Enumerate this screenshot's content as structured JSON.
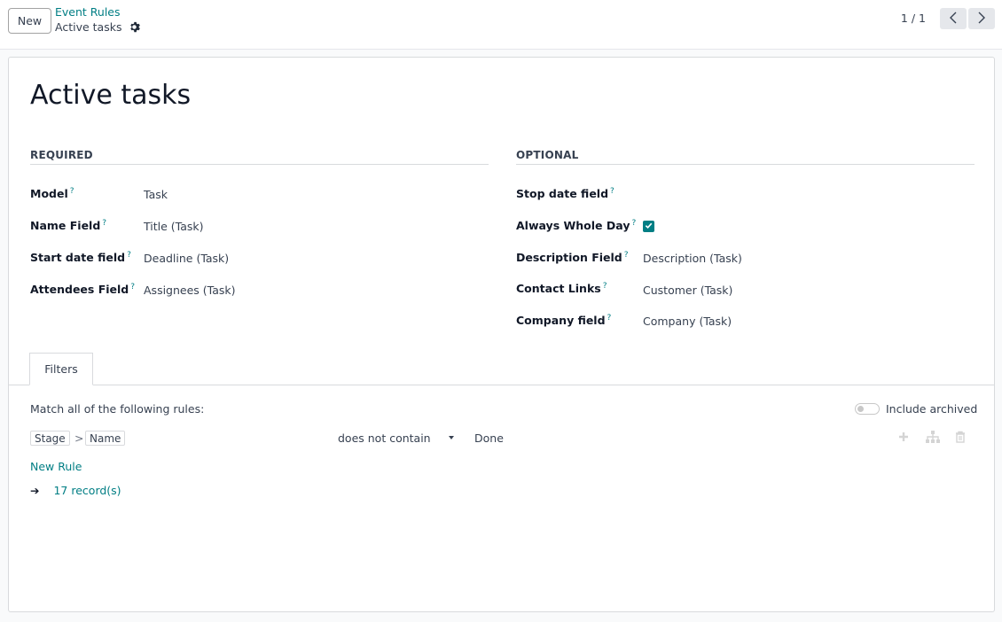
{
  "header": {
    "new_label": "New",
    "breadcrumb_parent": "Event Rules",
    "breadcrumb_current": "Active tasks",
    "pager": "1 / 1"
  },
  "record": {
    "title": "Active tasks"
  },
  "sections": {
    "required": "REQUIRED",
    "optional": "OPTIONAL"
  },
  "required_fields": [
    {
      "label": "Model",
      "value": "Task"
    },
    {
      "label": "Name Field",
      "value": "Title (Task)"
    },
    {
      "label": "Start date field",
      "value": "Deadline (Task)"
    },
    {
      "label": "Attendees Field",
      "value": "Assignees (Task)"
    }
  ],
  "optional_fields": [
    {
      "label": "Stop date field",
      "value": ""
    },
    {
      "label": "Always Whole Day",
      "value": "",
      "checked": true
    },
    {
      "label": "Description Field",
      "value": "Description (Task)"
    },
    {
      "label": "Contact Links",
      "value": "Customer (Task)"
    },
    {
      "label": "Company field",
      "value": "Company (Task)"
    }
  ],
  "help_mark": "?",
  "tabs": [
    {
      "label": "Filters"
    }
  ],
  "filters": {
    "match_text": "Match all of the following rules:",
    "include_archived": "Include archived",
    "include_archived_on": false,
    "rule": {
      "path": [
        "Stage",
        "Name"
      ],
      "path_separator": ">",
      "operator": "does not contain",
      "value": "Done"
    },
    "new_rule": "New Rule",
    "records": "17 record(s)",
    "records_arrow": "➔"
  },
  "colors": {
    "accent": "#017e84",
    "text": "#374151",
    "border": "#d8dadd"
  },
  "icons": [
    "gear-icon",
    "chevron-left-icon",
    "chevron-right-icon",
    "check-icon",
    "plus-icon",
    "hierarchy-icon",
    "trash-icon",
    "arrow-right-icon"
  ]
}
